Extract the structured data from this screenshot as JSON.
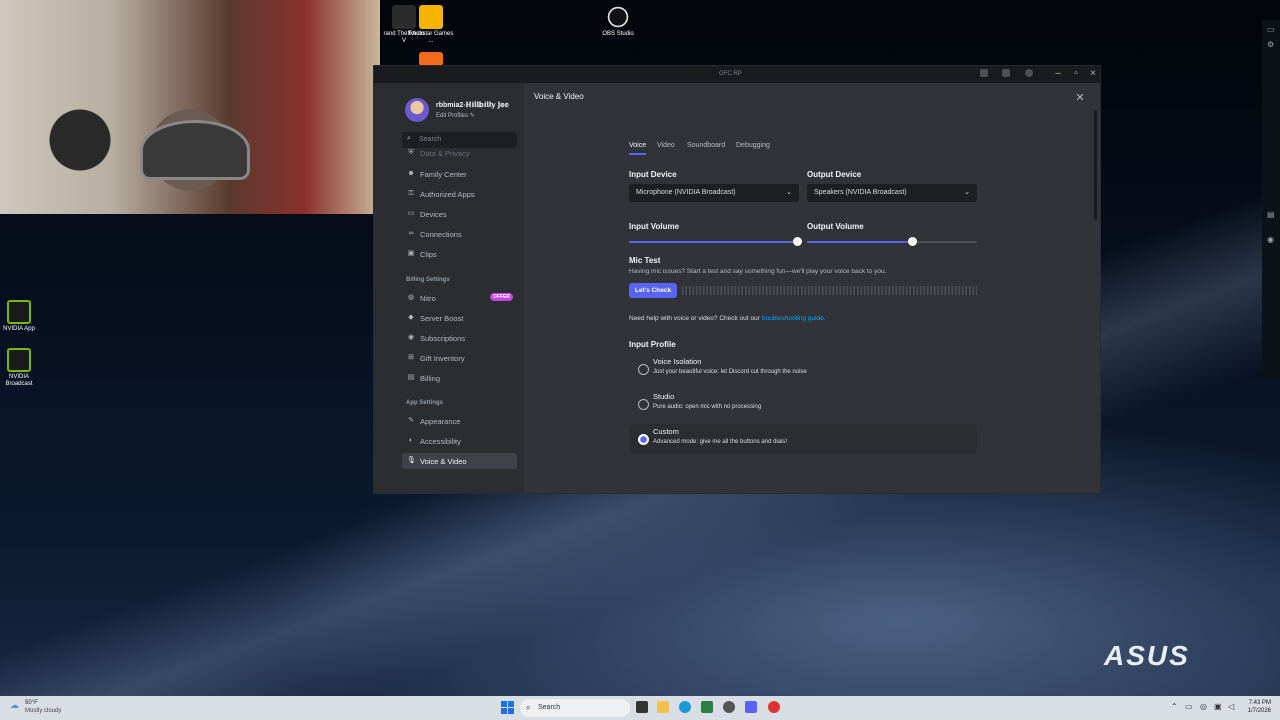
{
  "desktop": {
    "icons": [
      {
        "label": "rand Theft Auto V",
        "name": "gta-v-icon"
      },
      {
        "label": "Rockstar Games ...",
        "name": "rockstar-games-icon"
      },
      {
        "label": "OBS Studio",
        "name": "obs-studio-icon"
      },
      {
        "label": "NVIDIA App",
        "name": "nvidia-app-icon"
      },
      {
        "label": "NVIDIA Broadcast",
        "name": "nvidia-broadcast-icon"
      }
    ],
    "brand_logo": "ASUS"
  },
  "window": {
    "title": "GFC RP"
  },
  "profile": {
    "username": "rbbmia2-ℍ𝕚𝕝𝕝𝕓𝕚𝕝𝕝𝕪 𝕁𝕠𝕖",
    "edit_label": "Edit Profiles ✎"
  },
  "sidebar": {
    "search_placeholder": "Search",
    "user_items": [
      {
        "label": "Data & Privacy",
        "icon": "shield-icon"
      },
      {
        "label": "Family Center",
        "icon": "users-icon"
      },
      {
        "label": "Authorized Apps",
        "icon": "key-icon"
      },
      {
        "label": "Devices",
        "icon": "monitor-icon"
      },
      {
        "label": "Connections",
        "icon": "link-icon"
      },
      {
        "label": "Clips",
        "icon": "clip-icon"
      }
    ],
    "billing_header": "Billing Settings",
    "billing_items": [
      {
        "label": "Nitro",
        "icon": "nitro-icon",
        "badge": "OFFER"
      },
      {
        "label": "Server Boost",
        "icon": "boost-icon"
      },
      {
        "label": "Subscriptions",
        "icon": "subscriptions-icon"
      },
      {
        "label": "Gift Inventory",
        "icon": "gift-icon"
      },
      {
        "label": "Billing",
        "icon": "billing-icon"
      }
    ],
    "app_header": "App Settings",
    "app_items": [
      {
        "label": "Appearance",
        "icon": "palette-icon"
      },
      {
        "label": "Accessibility",
        "icon": "accessibility-icon"
      },
      {
        "label": "Voice & Video",
        "icon": "microphone-icon",
        "active": true
      }
    ]
  },
  "main": {
    "heading": "Voice & Video",
    "tabs": [
      {
        "label": "Voice",
        "active": true
      },
      {
        "label": "Video"
      },
      {
        "label": "Soundboard"
      },
      {
        "label": "Debugging"
      }
    ],
    "input_device": {
      "label": "Input Device",
      "value": "Microphone (NVIDIA Broadcast)"
    },
    "output_device": {
      "label": "Output Device",
      "value": "Speakers (NVIDIA Broadcast)"
    },
    "input_volume": {
      "label": "Input Volume",
      "level": 0.99
    },
    "output_volume": {
      "label": "Output Volume",
      "level": 0.62
    },
    "mic_test": {
      "label": "Mic Test",
      "description": "Having mic issues? Start a test and say something fun—we'll play your voice back to you.",
      "button": "Let's Check"
    },
    "help_text": "Need help with voice or video? Check out our",
    "help_link": "troubleshooting guide.",
    "input_profile": {
      "label": "Input Profile",
      "options": [
        {
          "title": "Voice Isolation",
          "desc": "Just your beautiful voice: let Discord cut through the noise",
          "selected": false
        },
        {
          "title": "Studio",
          "desc": "Pure audio: open mic with no processing",
          "selected": false
        },
        {
          "title": "Custom",
          "desc": "Advanced mode: give me all the buttons and dials!",
          "selected": true
        }
      ]
    }
  },
  "taskbar": {
    "weather_temp": "50°F",
    "weather_cond": "Mostly cloudy",
    "search_placeholder": "Search",
    "time": "7:43 PM",
    "date": "1/7/2026"
  },
  "colors": {
    "accent": "#5865f2",
    "offer_badge": "#c643e6",
    "link": "#00a8fc"
  }
}
